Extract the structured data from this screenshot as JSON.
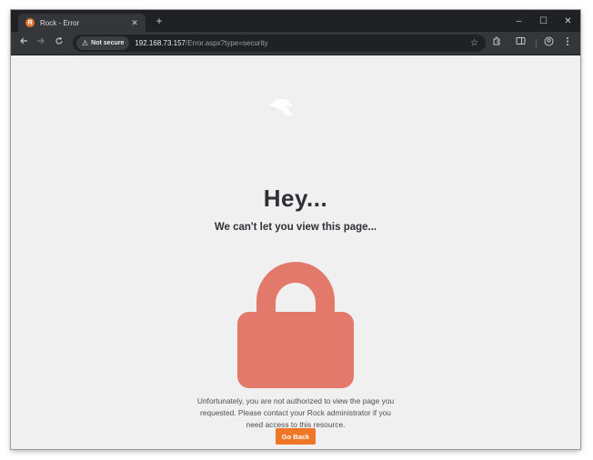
{
  "browser": {
    "tab_title": "Rock - Error",
    "tab_close": "✕",
    "new_tab": "+",
    "window_controls": {
      "minimize": "–",
      "maximize": "☐",
      "close": "✕"
    },
    "security_chip": "Not secure",
    "url_host": "192.168.73.157",
    "url_path": "/Error.aspx?type=security",
    "icons": {
      "back": "back-arrow-icon",
      "forward": "forward-arrow-icon",
      "reload": "reload-icon",
      "warning": "warning-icon",
      "bookmark": "star-icon",
      "extensions": "puzzle-icon",
      "side_panel": "side-panel-icon",
      "profile": "profile-icon",
      "menu": "kebab-menu-icon"
    }
  },
  "page": {
    "heading": "Hey...",
    "subheading": "We can't let you view this page...",
    "message": "Unfortunately, you are not authorized to view the page you requested. Please contact your Rock administrator if you need access to this resource.",
    "go_back_label": "Go Back",
    "colors": {
      "background": "#f0f0f0",
      "lock": "#e2796a",
      "button": "#ee7625",
      "text": "#2f3136"
    }
  }
}
